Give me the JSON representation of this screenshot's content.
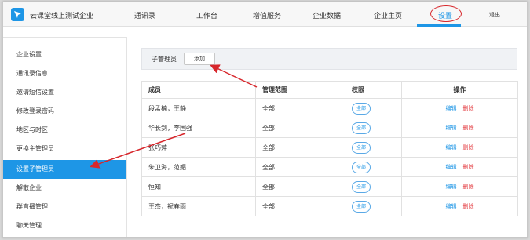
{
  "header": {
    "company_name": "云课堂线上测试企业",
    "nav": [
      {
        "label": "通讯录"
      },
      {
        "label": "工作台"
      },
      {
        "label": "增值服务"
      },
      {
        "label": "企业数据"
      },
      {
        "label": "企业主页"
      },
      {
        "label": "设置"
      }
    ],
    "active_nav": "设置",
    "logout_label": "退出"
  },
  "sidebar": {
    "items": [
      {
        "label": "企业设置"
      },
      {
        "label": "通讯录信息"
      },
      {
        "label": "邀请短信设置"
      },
      {
        "label": "修改登录密码"
      },
      {
        "label": "地区与时区"
      },
      {
        "label": "更换主管理员"
      },
      {
        "label": "设置子管理员"
      },
      {
        "label": "解散企业"
      },
      {
        "label": "群直播管理"
      },
      {
        "label": "聊天管理"
      }
    ],
    "active_item": "设置子管理员"
  },
  "toolbar": {
    "label": "子管理员",
    "add_label": "添加"
  },
  "table": {
    "headers": [
      "成员",
      "管理范围",
      "权限",
      "操作"
    ],
    "rows": [
      {
        "member": "段孟楠，王静",
        "scope": "全部",
        "permission": "全部",
        "edit": "编辑",
        "delete": "删除"
      },
      {
        "member": "华长剑，李国强",
        "scope": "全部",
        "permission": "全部",
        "edit": "编辑",
        "delete": "删除"
      },
      {
        "member": "张巧萍",
        "scope": "全部",
        "permission": "全部",
        "edit": "编辑",
        "delete": "删除"
      },
      {
        "member": "朱卫海，范媚",
        "scope": "全部",
        "permission": "全部",
        "edit": "编辑",
        "delete": "删除"
      },
      {
        "member": "恒知",
        "scope": "全部",
        "permission": "全部",
        "edit": "编辑",
        "delete": "删除"
      },
      {
        "member": "王杰，祝春雨",
        "scope": "全部",
        "permission": "全部",
        "edit": "编辑",
        "delete": "删除"
      }
    ]
  },
  "colors": {
    "accent": "#1e96e6",
    "danger": "#e2363b",
    "annotation": "#d7262b"
  }
}
